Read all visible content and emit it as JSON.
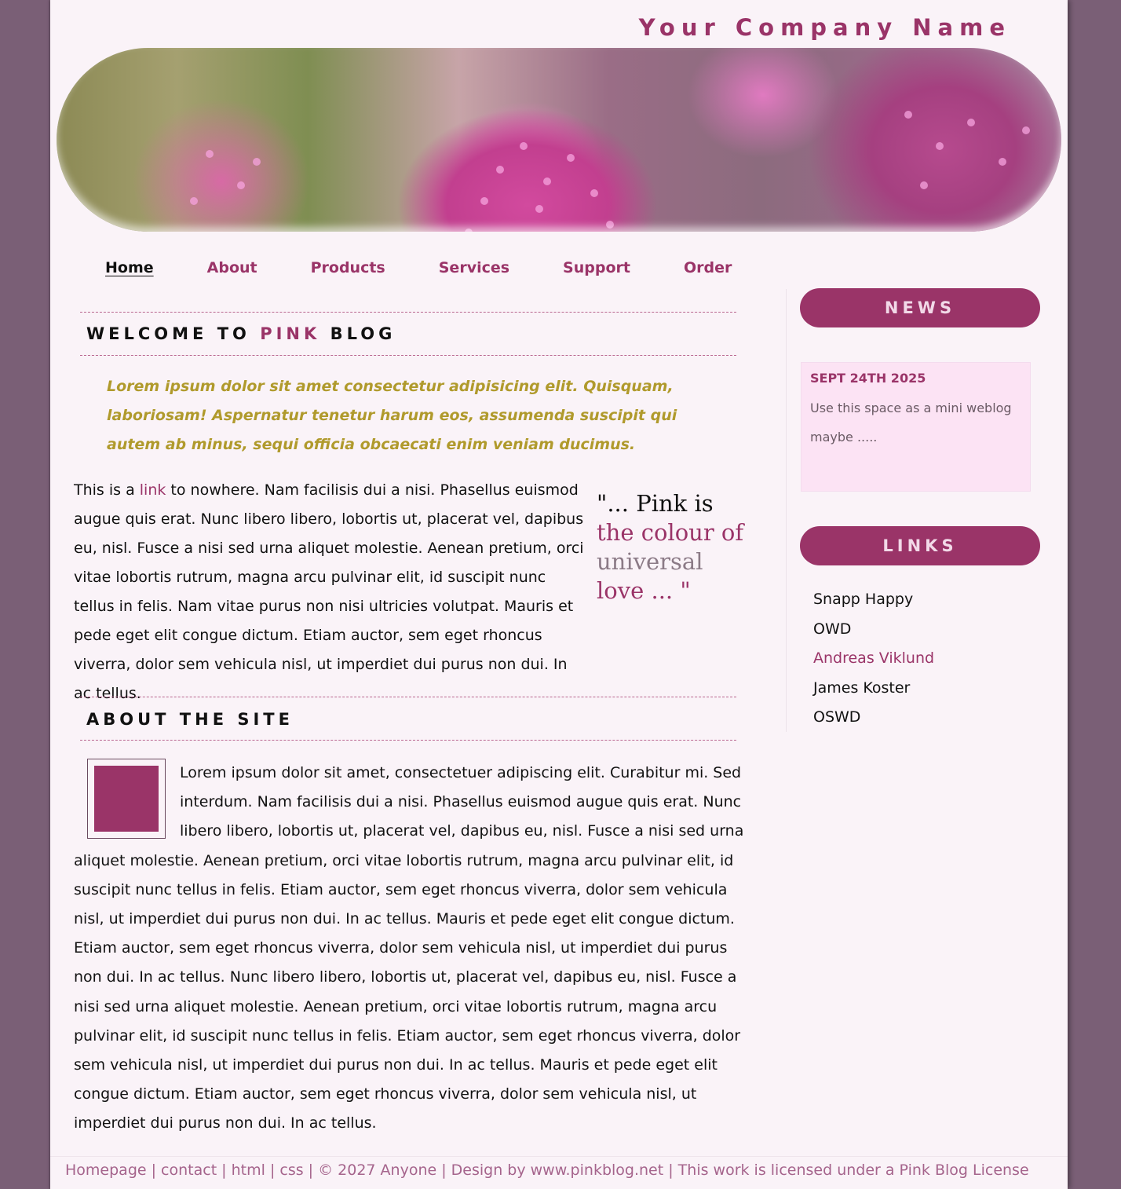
{
  "header": {
    "company": "Your Company Name"
  },
  "nav": {
    "items": [
      {
        "label": "Home",
        "active": true
      },
      {
        "label": "About"
      },
      {
        "label": "Products"
      },
      {
        "label": "Services"
      },
      {
        "label": "Support"
      },
      {
        "label": "Order"
      }
    ]
  },
  "welcome": {
    "title_pre": "WELCOME TO ",
    "title_pink": "PINK",
    "title_post": " BLOG",
    "intro": "Lorem ipsum dolor sit amet consectetur adipisicing elit. Quisquam, laboriosam! Aspernatur tenetur harum eos, assumenda suscipit qui autem ab minus, sequi officia obcaecati enim veniam ducimus.",
    "para_pre": "This is a ",
    "link": "link",
    "para_post": " to nowhere. Nam facilisis dui a nisi. Phasellus euismod augue quis erat. Nunc libero libero, lobortis ut, placerat vel, dapibus eu, nisl. Fusce a nisi sed urna aliquet molestie. Aenean pretium, orci vitae lobortis rutrum, magna arcu pulvinar elit, id suscipit nunc tellus in felis. Nam vitae purus non nisi ultricies volutpat. Mauris et pede eget elit congue dictum. Etiam auctor, sem eget rhoncus viverra, dolor sem vehicula nisl, ut imperdiet dui purus non dui. In ac tellus.",
    "quote": {
      "l1": "\"... Pink is",
      "l2": "the colour of",
      "l3": "universal",
      "l4": "love ... \""
    }
  },
  "about": {
    "title": "ABOUT THE SITE",
    "text": "Lorem ipsum dolor sit amet, consectetuer adipiscing elit. Curabitur mi. Sed interdum. Nam facilisis dui a nisi. Phasellus euismod augue quis erat. Nunc libero libero, lobortis ut, placerat vel, dapibus eu, nisl. Fusce a nisi sed urna aliquet molestie. Aenean pretium, orci vitae lobortis rutrum, magna arcu pulvinar elit, id suscipit nunc tellus in felis. Etiam auctor, sem eget rhoncus viverra, dolor sem vehicula nisl, ut imperdiet dui purus non dui. In ac tellus. Mauris et pede eget elit congue dictum. Etiam auctor, sem eget rhoncus viverra, dolor sem vehicula nisl, ut imperdiet dui purus non dui. In ac tellus. Nunc libero libero, lobortis ut, placerat vel, dapibus eu, nisl. Fusce a nisi sed urna aliquet molestie. Aenean pretium, orci vitae lobortis rutrum, magna arcu pulvinar elit, id suscipit nunc tellus in felis. Etiam auctor, sem eget rhoncus viverra, dolor sem vehicula nisl, ut imperdiet dui purus non dui. In ac tellus. Mauris et pede eget elit congue dictum. Etiam auctor, sem eget rhoncus viverra, dolor sem vehicula nisl, ut imperdiet dui purus non dui. In ac tellus."
  },
  "sidebar": {
    "news_title": "NEWS",
    "news_date": "SEPT 24TH 2025",
    "news_text": "Use this space as a mini weblog maybe .....",
    "links_title": "LINKS",
    "links": [
      "Snapp Happy",
      "OWD",
      "Andreas Viklund",
      "James Koster",
      "OSWD"
    ]
  },
  "footer": {
    "text": "Homepage | contact | html | css | © 2027 Anyone | Design by www.pinkblog.net | This work is licensed under a Pink Blog License"
  },
  "colors": {
    "accent": "#9a3468",
    "intro": "#b09a2c",
    "background": "#7a5f76",
    "page": "#faf3f8"
  }
}
